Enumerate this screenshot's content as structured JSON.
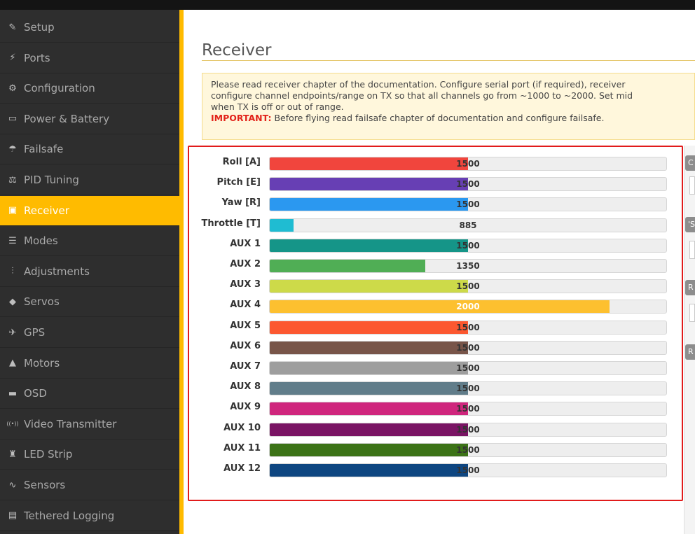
{
  "sidebar": {
    "items": [
      {
        "label": "Setup",
        "icon": "wrench-icon",
        "glyph": "✎",
        "active": false
      },
      {
        "label": "Ports",
        "icon": "plug-icon",
        "glyph": "⚡",
        "active": false
      },
      {
        "label": "Configuration",
        "icon": "gear-icon",
        "glyph": "⚙",
        "active": false
      },
      {
        "label": "Power & Battery",
        "icon": "battery-icon",
        "glyph": "▭",
        "active": false
      },
      {
        "label": "Failsafe",
        "icon": "parachute-icon",
        "glyph": "☂",
        "active": false
      },
      {
        "label": "PID Tuning",
        "icon": "sliders-icon",
        "glyph": "⚖",
        "active": false
      },
      {
        "label": "Receiver",
        "icon": "receiver-icon",
        "glyph": "▣",
        "active": true
      },
      {
        "label": "Modes",
        "icon": "toggle-icon",
        "glyph": "☰",
        "active": false
      },
      {
        "label": "Adjustments",
        "icon": "adjustments-icon",
        "glyph": "⫶",
        "active": false
      },
      {
        "label": "Servos",
        "icon": "servo-icon",
        "glyph": "◆",
        "active": false
      },
      {
        "label": "GPS",
        "icon": "satellite-icon",
        "glyph": "✈",
        "active": false
      },
      {
        "label": "Motors",
        "icon": "motor-icon",
        "glyph": "▲",
        "active": false
      },
      {
        "label": "OSD",
        "icon": "osd-icon",
        "glyph": "▬",
        "active": false
      },
      {
        "label": "Video Transmitter",
        "icon": "antenna-icon",
        "glyph": "((•))",
        "active": false
      },
      {
        "label": "LED Strip",
        "icon": "led-icon",
        "glyph": "♜",
        "active": false
      },
      {
        "label": "Sensors",
        "icon": "pulse-icon",
        "glyph": "∿",
        "active": false
      },
      {
        "label": "Tethered Logging",
        "icon": "log-icon",
        "glyph": "▤",
        "active": false
      }
    ]
  },
  "page": {
    "title": "Receiver"
  },
  "notice": {
    "line1": "Please read receiver chapter of the documentation. Configure serial port (if required), receiver",
    "line2": "configure channel endpoints/range on TX so that all channels go from ~1000 to ~2000. Set mid",
    "line3": "when TX is off or out of range.",
    "important_label": "IMPORTANT:",
    "important_text": " Before flying read failsafe chapter of documentation and configure failsafe."
  },
  "channels": {
    "range": [
      800,
      2200
    ],
    "items": [
      {
        "label": "Roll [A]",
        "value": 1500,
        "display": "1500",
        "color": "#f1453d"
      },
      {
        "label": "Pitch [E]",
        "value": 1500,
        "display": "1500",
        "color": "#673fb4"
      },
      {
        "label": "Yaw [R]",
        "value": 1500,
        "display": "1500",
        "color": "#2b98f0"
      },
      {
        "label": "Throttle [T]",
        "value": 885,
        "display": "885",
        "color": "#1fbcd2"
      },
      {
        "label": "AUX 1",
        "value": 1500,
        "display": "1500",
        "color": "#159588"
      },
      {
        "label": "AUX 2",
        "value": 1350,
        "display": "1350",
        "color": "#50ae55"
      },
      {
        "label": "AUX 3",
        "value": 1500,
        "display": "1500",
        "color": "#cdda49"
      },
      {
        "label": "AUX 4",
        "value": 2000,
        "display": "2000",
        "color": "#fdc02f"
      },
      {
        "label": "AUX 5",
        "value": 1500,
        "display": "1500",
        "color": "#fc5830"
      },
      {
        "label": "AUX 6",
        "value": 1500,
        "display": "1500",
        "color": "#785549"
      },
      {
        "label": "AUX 7",
        "value": 1500,
        "display": "1500",
        "color": "#9e9e9e"
      },
      {
        "label": "AUX 8",
        "value": 1500,
        "display": "1500",
        "color": "#617d8a"
      },
      {
        "label": "AUX 9",
        "value": 1500,
        "display": "1500",
        "color": "#cf267d"
      },
      {
        "label": "AUX 10",
        "value": 1500,
        "display": "1500",
        "color": "#7a1464"
      },
      {
        "label": "AUX 11",
        "value": 1500,
        "display": "1500",
        "color": "#3c7317"
      },
      {
        "label": "AUX 12",
        "value": 1500,
        "display": "1500",
        "color": "#0e4681"
      }
    ]
  },
  "right_panel": {
    "tabs": [
      "C",
      "'S",
      "R",
      "R"
    ]
  }
}
